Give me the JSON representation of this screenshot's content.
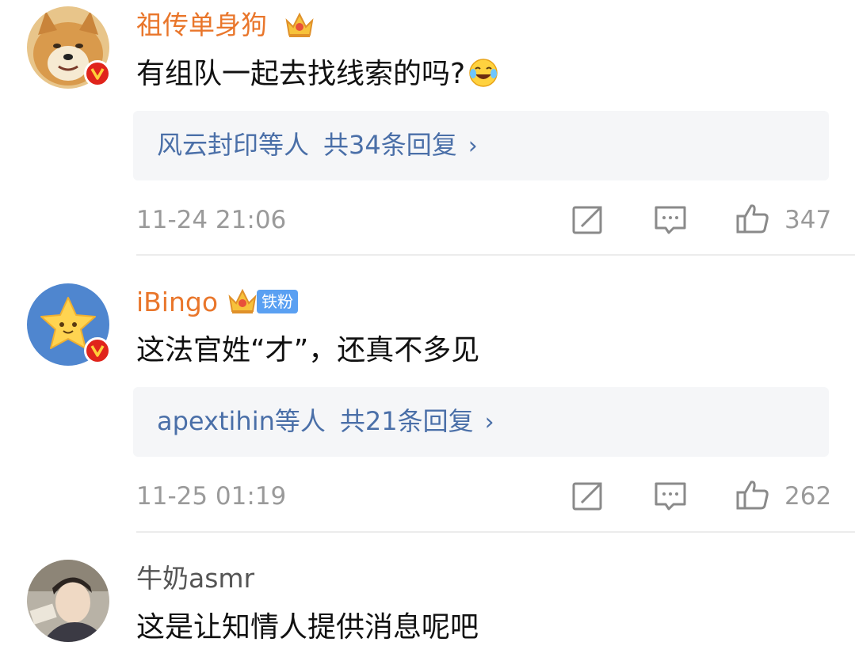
{
  "comments": [
    {
      "username": "祖传单身狗",
      "text": "有组队一起去找线索的吗?",
      "emoji_icon": "laughing-tears-emoji",
      "replies": {
        "names": "风云封印等人",
        "count": "共34条回复",
        "chevron": "›"
      },
      "time": "11-24 21:06",
      "likes": "347"
    },
    {
      "username": "iBingo",
      "fan_tag": "铁粉",
      "text": "这法官姓“才”，还真不多见",
      "replies": {
        "names": "apextihin等人",
        "count": "共21条回复",
        "chevron": "›"
      },
      "time": "11-25 01:19",
      "likes": "262"
    },
    {
      "username": "牛奶asmr",
      "text": "这是让知情人提供消息呢吧"
    }
  ],
  "colors": {
    "vip_name": "#e9762b",
    "reply_link": "#4a6fa8",
    "meta_gray": "#9a9a9a",
    "verified_badge": "#e0241b",
    "fan_tag": "#5aa0f2"
  },
  "icons": [
    "crown-icon",
    "verified-badge-icon",
    "share-icon",
    "comment-icon",
    "like-icon",
    "chevron-right-icon"
  ]
}
